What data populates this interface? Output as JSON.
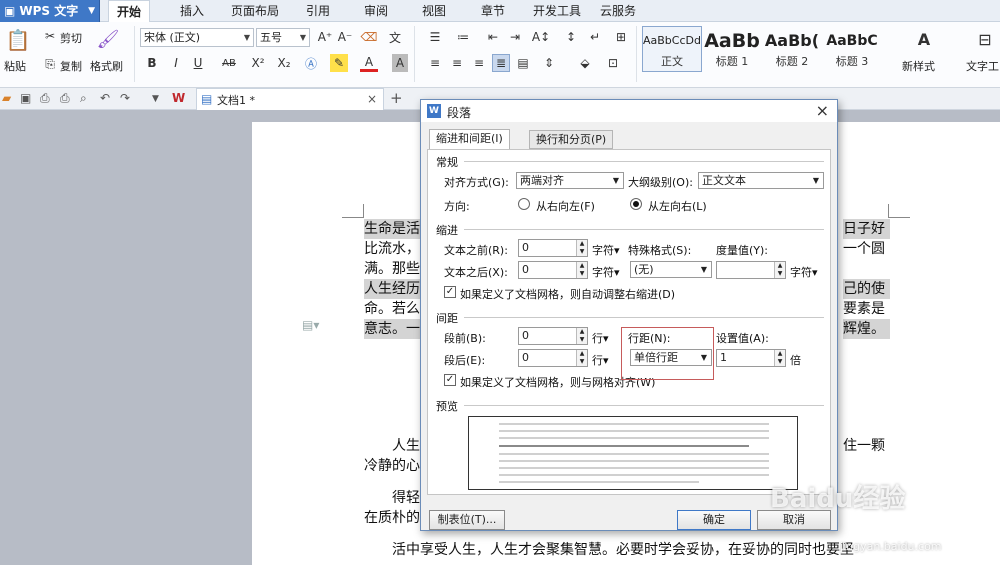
{
  "app": {
    "name": "WPS 文字",
    "logo": "W"
  },
  "menu": [
    "开始",
    "插入",
    "页面布局",
    "引用",
    "审阅",
    "视图",
    "章节",
    "开发工具",
    "云服务"
  ],
  "ribbon": {
    "paste": "粘贴",
    "cut": "剪切",
    "copy": "复制",
    "format_painter": "格式刷",
    "font_name": "宋体 (正文)",
    "font_size": "五号",
    "bold": "B",
    "italic": "I",
    "underline": "U",
    "strike": "AB",
    "sup": "X²",
    "sub": "X₂",
    "styles": [
      {
        "preview": "AaBbCcDd",
        "name": "正文"
      },
      {
        "preview": "AaBb",
        "name": "标题 1"
      },
      {
        "preview": "AaBb(",
        "name": "标题 2"
      },
      {
        "preview": "AaBbC",
        "name": "标题 3"
      }
    ],
    "new_style": "新样式",
    "text_tool": "文字工"
  },
  "tab": {
    "title": "文档1 *"
  },
  "document": {
    "lines": [
      "生命是活",
      "比流水，",
      "满。那些",
      "人生经历",
      "命。若么",
      "意志。一"
    ],
    "right_lines": [
      "日子好",
      "一个圆",
      "",
      "己的使",
      "要素是",
      "辉煌。"
    ],
    "p2_start": "人生",
    "p2_end": "住一颗",
    "p2_line2": "冷静的心",
    "p3_start": "得轻",
    "p3_line2": "在质朴的",
    "p4": "活中享受人生，人生才会聚集智慧。必要时学会妥协，在妥协的同时也要坚"
  },
  "dialog": {
    "title": "段落",
    "tabs": [
      "缩进和间距(I)",
      "换行和分页(P)"
    ],
    "general": "常规",
    "alignment_label": "对齐方式(G):",
    "alignment_value": "两端对齐",
    "outline_label": "大纲级别(O):",
    "outline_value": "正文文本",
    "direction_label": "方向:",
    "rtl": "从右向左(F)",
    "ltr": "从左向右(L)",
    "indent": "缩进",
    "before_text_label": "文本之前(R):",
    "before_text_value": "0",
    "after_text_label": "文本之后(X):",
    "after_text_value": "0",
    "unit_char": "字符",
    "special_label": "特殊格式(S):",
    "special_value": "(无)",
    "measure_label": "度量值(Y):",
    "measure_value": "",
    "grid_indent": "如果定义了文档网格，则自动调整右缩进(D)",
    "spacing": "间距",
    "before_label": "段前(B):",
    "before_value": "0",
    "after_label": "段后(E):",
    "after_value": "0",
    "unit_line": "行",
    "line_spacing_label": "行距(N):",
    "line_spacing_value": "单倍行距",
    "setting_label": "设置值(A):",
    "setting_value": "1",
    "unit_times": "倍",
    "grid_snap": "如果定义了文档网格，则与网格对齐(W)",
    "preview": "预览",
    "tabs_button": "制表位(T)...",
    "ok": "确定",
    "cancel": "取消"
  },
  "watermark": "Baidu经验",
  "watermark_url": "jingyan.baidu.com"
}
